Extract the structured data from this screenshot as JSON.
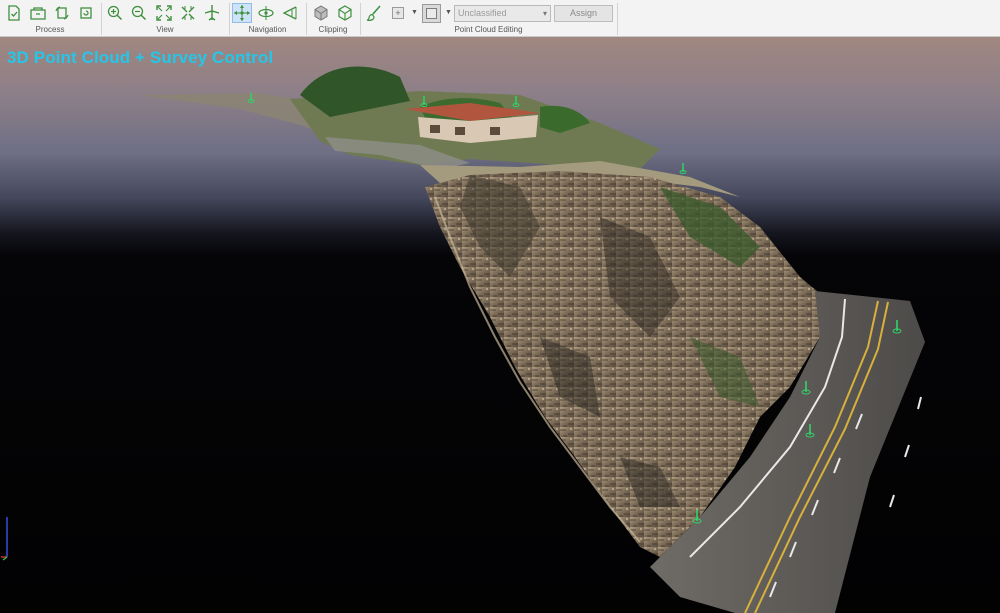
{
  "toolbar": {
    "groups": {
      "process": "Process",
      "view": "View",
      "navigation": "Navigation",
      "clipping": "Clipping",
      "point_cloud_editing": "Point Cloud Editing"
    },
    "classification_select": {
      "value": "Unclassified"
    },
    "assign_label": "Assign",
    "add_symbol": "+",
    "colors": {
      "icon_green": "#3f8f3f",
      "active_bg": "#cde3f7"
    }
  },
  "viewport": {
    "title": "3D Point Cloud + Survey Control",
    "title_color": "#25c6e8",
    "survey_marker_color": "#2fd36a",
    "icons": [
      "survey-control-marker-icon",
      "axis-triad-icon"
    ]
  }
}
